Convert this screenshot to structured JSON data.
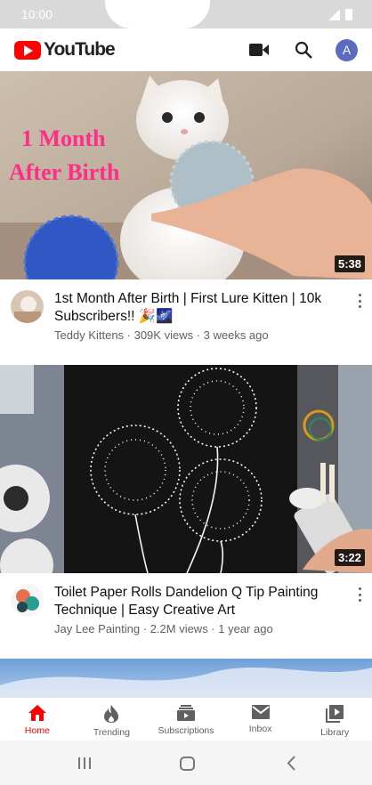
{
  "status_bar": {
    "time": "10:00"
  },
  "header": {
    "logo_text": "YouTube",
    "avatar_letter": "A"
  },
  "videos": [
    {
      "thumbnail_text": "1 Month After Birth",
      "thumbnail_line1": "1 Month",
      "thumbnail_line2": "After Birth",
      "duration": "5:38",
      "title": "1st Month After Birth | First Lure Kitten | 10k Subscribers!! 🎉🌌",
      "channel": "Teddy Kittens",
      "views": "309K views",
      "age": "3 weeks ago",
      "subline": "Teddy Kittens · 309K views · 3 weeks ago"
    },
    {
      "duration": "3:22",
      "title": "Toilet Paper Rolls Dandelion Q Tip Painting Technique |  Easy Creative Art",
      "channel": "Jay Lee Painting",
      "views": "2.2M views",
      "age": "1 year ago",
      "subline": "Jay Lee Painting · 2.2M views · 1 year ago"
    }
  ],
  "bottom_nav": [
    {
      "label": "Home",
      "icon": "home-icon",
      "active": true
    },
    {
      "label": "Trending",
      "icon": "flame-icon",
      "active": false
    },
    {
      "label": "Subscriptions",
      "icon": "subscriptions-icon",
      "active": false
    },
    {
      "label": "Inbox",
      "icon": "mail-icon",
      "active": false
    },
    {
      "label": "Library",
      "icon": "library-icon",
      "active": false
    }
  ],
  "colors": {
    "brand_red": "#ff0000",
    "text_primary": "#0f0f0f",
    "text_secondary": "#606060",
    "avatar_bg": "#5c6bc0"
  }
}
